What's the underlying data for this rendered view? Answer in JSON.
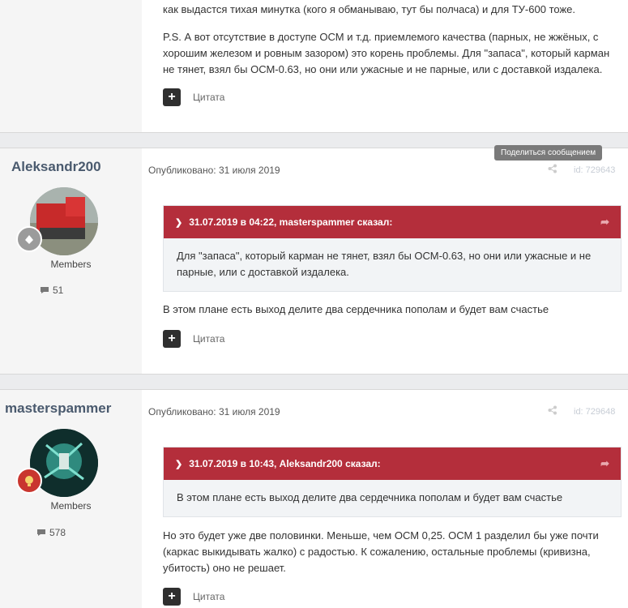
{
  "post_top": {
    "line1": "как выдастся тихая минутка (кого я обманываю, тут бы полчаса) и для ТУ-600 тоже.",
    "ps": "P.S. А вот отсутствие в доступе ОСМ и т.д. приемлемого качества (парных, не жжёных, с хорошим железом и ровным зазором) это корень проблемы. Для \"запаса\", который карман не тянет, взял бы ОСМ-0.63, но они или ужасные и не парные, или с доставкой издалека.",
    "cite_label": "Цитата"
  },
  "tooltip": "Поделиться сообщением",
  "posts": [
    {
      "username": "Aleksandr200",
      "group": "Members",
      "post_count": "51",
      "published": "Опубликовано: 31 июля 2019",
      "post_id": "id: 729643",
      "quote_header": "31.07.2019 в 04:22, masterspammer сказал:",
      "quote_body": "Для \"запаса\", который карман не тянет, взял бы ОСМ-0.63, но они или ужасные и не парные, или с доставкой издалека.",
      "text": "В этом плане есть выход делите два сердечника пополам и будет вам счастье",
      "cite_label": "Цитата"
    },
    {
      "username": "masterspammer",
      "group": "Members",
      "post_count": "578",
      "published": "Опубликовано: 31 июля 2019",
      "post_id": "id: 729648",
      "quote_header": "31.07.2019 в 10:43, Aleksandr200 сказал:",
      "quote_body": "В этом плане есть выход делите два сердечника пополам и будет вам счастье",
      "text": "Но это будет уже две половинки. Меньше, чем ОСМ 0,25. ОСМ 1 разделил бы уже почти (каркас выкидывать жалко) с радостью. К сожалению, остальные проблемы (кривизна, убитость) оно не решает.",
      "cite_label": "Цитата"
    }
  ]
}
